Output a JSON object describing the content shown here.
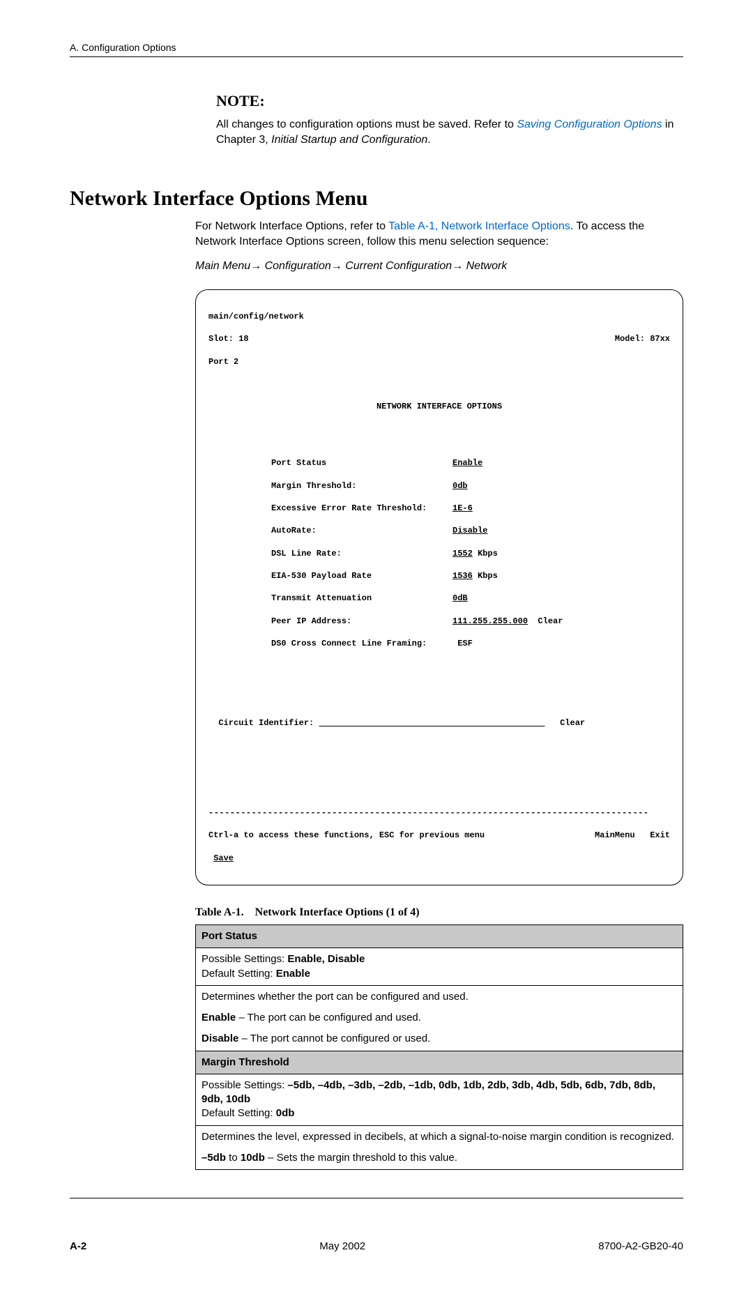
{
  "header": "A. Configuration Options",
  "note": {
    "title": "NOTE:",
    "text1": "All changes to configuration options must be saved. Refer to ",
    "link": "Saving Configuration Options",
    "text2": " in Chapter 3, ",
    "em": "Initial Startup and Configuration",
    "text3": "."
  },
  "section_title": "Network Interface Options Menu",
  "intro": {
    "t1": "For Network Interface Options, refer to ",
    "link": "Table A-1, Network Interface Options",
    "t2": ". To access the Network Interface Options screen, follow this menu selection sequence:"
  },
  "path": "Main Menu→ Configuration→ Current Configuration→ Network",
  "terminal": {
    "breadcrumb": "main/config/network",
    "slot": "Slot: 18",
    "model": "Model: 87xx",
    "port": "Port 2",
    "title": "NETWORK INTERFACE OPTIONS",
    "opts": [
      {
        "label": "Port Status",
        "value": "Enable",
        "u": true
      },
      {
        "label": "Margin Threshold:",
        "value": "0db",
        "u": true
      },
      {
        "label": "Excessive Error Rate Threshold:",
        "value": "1E-6",
        "u": true
      },
      {
        "label": "AutoRate:",
        "value": "Disable",
        "u": true
      },
      {
        "label": "DSL Line Rate:",
        "value": "1552",
        "suffix": " Kbps",
        "u": true
      },
      {
        "label": "EIA-530 Payload Rate",
        "value": "1536",
        "suffix": " Kbps",
        "u": true
      },
      {
        "label": "Transmit Attenuation",
        "value": "0dB",
        "u": true
      },
      {
        "label": "Peer IP Address:",
        "value": "111.255.255.000",
        "suffix": "  Clear",
        "u": true
      },
      {
        "label": "DS0 Cross Connect Line Framing:",
        "value": "ESF",
        "u": false,
        "pad": true
      }
    ],
    "circuit_label": "Circuit Identifier:",
    "circuit_clear": "Clear",
    "help": "Ctrl-a to access these functions, ESC for previous menu",
    "menu1": "MainMenu",
    "menu2": "Exit",
    "save": "Save"
  },
  "table": {
    "caption": "Table A-1. Network Interface Options  (1 of 4)",
    "rows": {
      "h1": "Port Status",
      "r1a": "Possible Settings: ",
      "r1a_b": "Enable, Disable",
      "r1b": "Default Setting: ",
      "r1b_b": "Enable",
      "r2": "Determines whether the port can be configured and used.",
      "r2b_b": "Enable",
      "r2b": " – The port can be configured and used.",
      "r2c_b": "Disable",
      "r2c": " – The port cannot be configured or used.",
      "h2": "Margin Threshold",
      "r3a": "Possible Settings: ",
      "r3a_b": "–5db, –4db, –3db, –2db, –1db, 0db, 1db, 2db, 3db, 4db, 5db, 6db, 7db, 8db, 9db, 10db",
      "r3b": "Default Setting: ",
      "r3b_b": "0db",
      "r4": "Determines the level, expressed in decibels, at which a signal-to-noise margin condition is recognized.",
      "r4b_b": "–5db",
      "r4b_m": " to ",
      "r4b_b2": "10db",
      "r4b": " – Sets the margin threshold to this value."
    }
  },
  "footer": {
    "left": "A-2",
    "mid": "May 2002",
    "right": "8700-A2-GB20-40"
  }
}
